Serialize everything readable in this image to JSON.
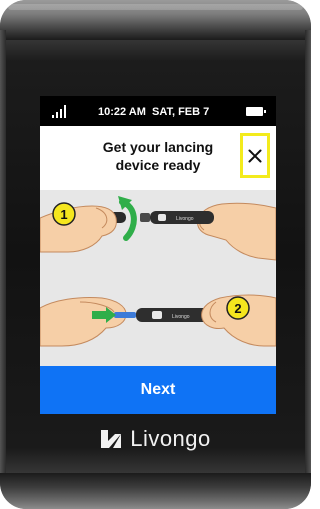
{
  "status_bar": {
    "time": "10:22 AM",
    "date": "SAT, FEB 7",
    "signal_icon": "signal-bars-icon",
    "battery_icon": "battery-full-icon"
  },
  "header": {
    "title": "Get your lancing\ndevice ready",
    "close_icon": "close-icon",
    "close_highlight_color": "#f3eb1c"
  },
  "illustration": {
    "steps": [
      {
        "number": "1",
        "action": "twist-cap-off"
      },
      {
        "number": "2",
        "action": "insert-lancet"
      }
    ],
    "device_label": "Livongo",
    "marker_color": "#f5e61e",
    "arrow_color": "#2fae49"
  },
  "next_button": {
    "label": "Next",
    "color": "#0f73f5"
  },
  "brand": {
    "name": "Livongo",
    "logo_icon": "livongo-mark-icon"
  }
}
